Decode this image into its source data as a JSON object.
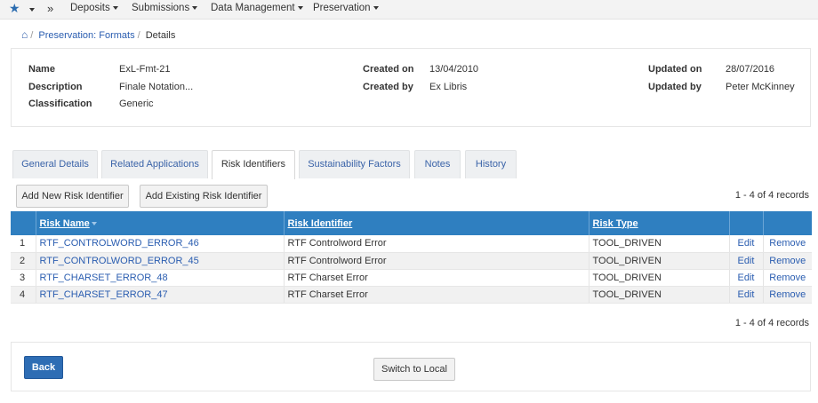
{
  "nav": {
    "items": [
      {
        "label": "Deposits"
      },
      {
        "label": "Submissions"
      },
      {
        "label": "Data Management"
      },
      {
        "label": "Preservation"
      }
    ],
    "more": "»"
  },
  "breadcrumb": {
    "sep": "/",
    "parent": "Preservation: Formats",
    "current": "Details"
  },
  "details": {
    "name_label": "Name",
    "name_value": "ExL-Fmt-21",
    "description_label": "Description",
    "description_value": "Finale Notation...",
    "classification_label": "Classification",
    "classification_value": "Generic",
    "created_on_label": "Created on",
    "created_on_value": "13/04/2010",
    "created_by_label": "Created by",
    "created_by_value": "Ex Libris",
    "updated_on_label": "Updated on",
    "updated_on_value": "28/07/2016",
    "updated_by_label": "Updated by",
    "updated_by_value": "Peter McKinney"
  },
  "tabs": [
    {
      "label": "General Details"
    },
    {
      "label": "Related Applications"
    },
    {
      "label": "Risk Identifiers"
    },
    {
      "label": "Sustainability Factors"
    },
    {
      "label": "Notes"
    },
    {
      "label": "History"
    }
  ],
  "actions": {
    "add_new": "Add New Risk Identifier",
    "add_existing": "Add Existing Risk Identifier",
    "records_top": "1 - 4 of 4 records",
    "records_bottom": "1 - 4 of 4 records"
  },
  "table": {
    "headers": {
      "risk_name": "Risk Name",
      "risk_identifier": "Risk Identifier",
      "risk_type": "Risk Type"
    },
    "rows": [
      {
        "num": "1",
        "name": "RTF_CONTROLWORD_ERROR_46",
        "identifier": "RTF Controlword Error",
        "type": "TOOL_DRIVEN",
        "edit": "Edit",
        "remove": "Remove"
      },
      {
        "num": "2",
        "name": "RTF_CONTROLWORD_ERROR_45",
        "identifier": "RTF Controlword Error",
        "type": "TOOL_DRIVEN",
        "edit": "Edit",
        "remove": "Remove"
      },
      {
        "num": "3",
        "name": "RTF_CHARSET_ERROR_48",
        "identifier": "RTF Charset Error",
        "type": "TOOL_DRIVEN",
        "edit": "Edit",
        "remove": "Remove"
      },
      {
        "num": "4",
        "name": "RTF_CHARSET_ERROR_47",
        "identifier": "RTF Charset Error",
        "type": "TOOL_DRIVEN",
        "edit": "Edit",
        "remove": "Remove"
      }
    ]
  },
  "footer": {
    "back": "Back",
    "switch_local": "Switch to Local"
  },
  "colors": {
    "header_blue": "#2f7fc0",
    "link_blue": "#2a5db0",
    "primary_button": "#2e6db4"
  }
}
